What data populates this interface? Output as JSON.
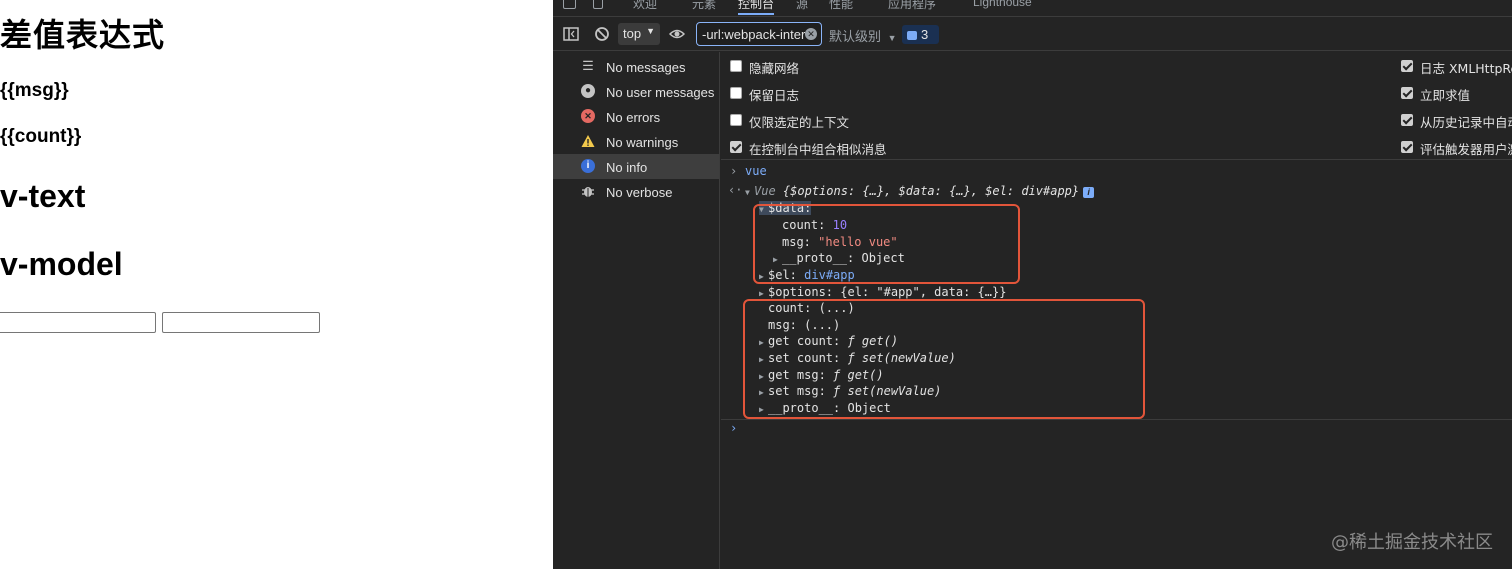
{
  "page": {
    "heading": "差值表达式",
    "msg_text": "{{msg}}",
    "count_text": "{{count}}",
    "vtext_heading": "v-text",
    "vmodel_heading": "v-model"
  },
  "devtools": {
    "tabs": [
      "欢迎",
      "元素",
      "控制台",
      "源",
      "性能",
      "应用程序",
      "Lighthouse"
    ],
    "active_tab": "控制台",
    "toolbar": {
      "context": "top",
      "filter_value": "-url:webpack-inter",
      "levels": "默认级别",
      "issues_count": "3"
    },
    "sidebar": [
      {
        "label": "No messages",
        "icon": "list-icon"
      },
      {
        "label": "No user messages",
        "icon": "user-icon"
      },
      {
        "label": "No errors",
        "icon": "error-icon"
      },
      {
        "label": "No warnings",
        "icon": "warning-icon"
      },
      {
        "label": "No info",
        "icon": "info-icon"
      },
      {
        "label": "No verbose",
        "icon": "bug-icon"
      }
    ],
    "settings_left": [
      {
        "label": "隐藏网络",
        "checked": false
      },
      {
        "label": "保留日志",
        "checked": false
      },
      {
        "label": "仅限选定的上下文",
        "checked": false
      },
      {
        "label": "在控制台中组合相似消息",
        "checked": true
      }
    ],
    "settings_right": [
      {
        "label": "日志 XMLHttpRe",
        "checked": true
      },
      {
        "label": "立即求值",
        "checked": true
      },
      {
        "label": "从历史记录中自动",
        "checked": true
      },
      {
        "label": "评估触发器用户激",
        "checked": true
      }
    ],
    "console": {
      "input": "vue",
      "result_name": "Vue",
      "result_summary": "{$options: {…}, $data: {…}, $el: div#app}",
      "data_key": "$data:",
      "count_line": {
        "key": "count:",
        "value": "10"
      },
      "msg_line": {
        "key": "msg:",
        "value": "\"hello vue\""
      },
      "proto_line": {
        "key": "__proto__:",
        "value": "Object"
      },
      "el_line": {
        "key": "$el:",
        "value": "div#app"
      },
      "options_line": {
        "key": "$options:",
        "value": "{el: \"#app\", data: {…}}"
      },
      "count_getter": "count: (...)",
      "msg_getter": "msg: (...)",
      "get_count": {
        "key": "get count:",
        "value": "ƒ get()"
      },
      "set_count": {
        "key": "set count:",
        "value": "ƒ set(newValue)"
      },
      "get_msg": {
        "key": "get msg:",
        "value": "ƒ get()"
      },
      "set_msg": {
        "key": "set msg:",
        "value": "ƒ set(newValue)"
      },
      "proto2": {
        "key": "__proto__:",
        "value": "Object"
      }
    },
    "colors": {
      "highlight_box": "#e2553a",
      "accent": "#7cacf8"
    }
  },
  "watermark": "@稀土掘金技术社区"
}
